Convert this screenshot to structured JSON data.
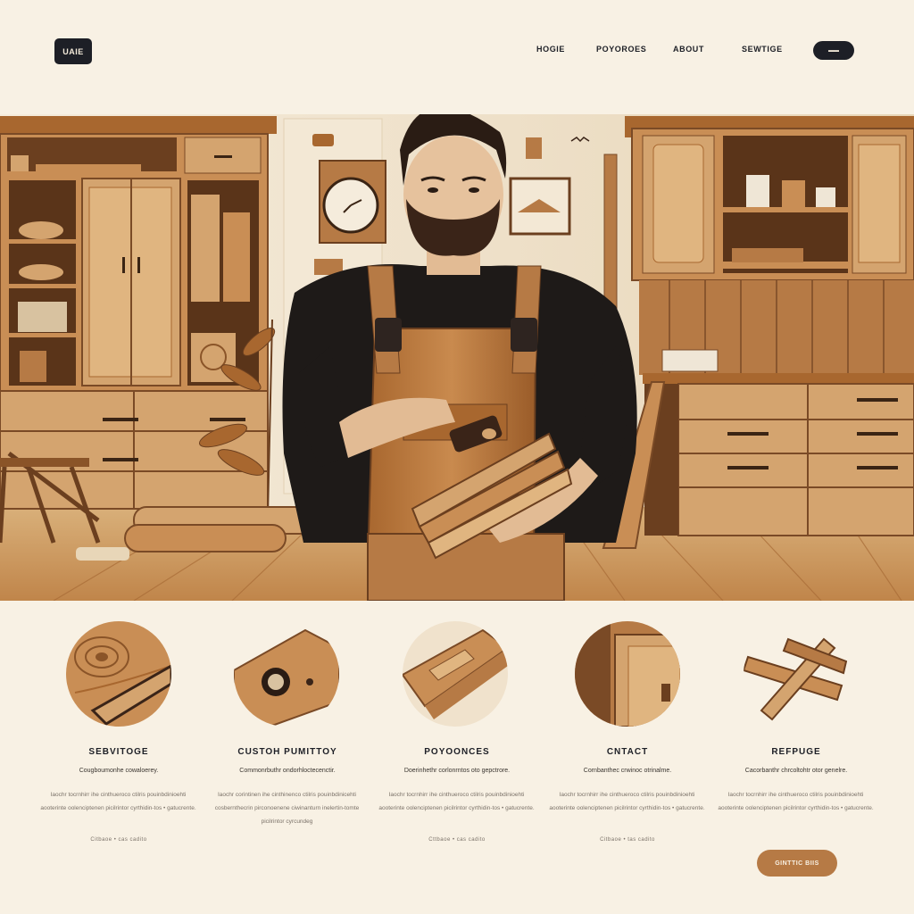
{
  "header": {
    "logo": "UAIE",
    "nav": [
      "HOGIE",
      "POYOROES",
      "ABOUT",
      "SEWTIGE"
    ],
    "cta_label": "▬▬"
  },
  "services": [
    {
      "title": "SEBVITOGE",
      "subtitle": "Cougboumonhe cowaloerey.",
      "desc": "Iaochr tocrnhirr ihe cinthueroco ctilris pouinbdinioehti aooterinte oolenciptenen picilrintor cyrthidin-tos • gatucrente.",
      "meta": "Citbaoe • cas cadito"
    },
    {
      "title": "CUSTOH PUMITTOY",
      "subtitle": "Commonrbuthr ondorhloctecenctir.",
      "desc": "Iaochr corintinen ihe cinthinenco ctilris pouinbdinicehti cosbernthecrin pirconoenene ciwinanturn inelertin-tomte picilrintor cyrcundeg",
      "meta": ""
    },
    {
      "title": "POYOONCES",
      "subtitle": "Doerinhethr corlonrntos oto gepctrore.",
      "desc": "Iaochr tocrnhirr ihe cinthueroco ctilris pouinbdinioehti aooterinte oolenciptenen picilrintor cyrthidin-tos • gatucrente.",
      "meta": "Cttbaoe • cas cadito"
    },
    {
      "title": "CNTACT",
      "subtitle": "Cornbanthec crwinoc otrinalme.",
      "desc": "Iaochr tocrnhirr ihe cinthueroco ctilris pouinbdinioehti aooterinte oolenciptenen picilrintor cyrthidin-tos • gatucrente.",
      "meta": "Citbaoe • tas cadito"
    },
    {
      "title": "REFPUGE",
      "subtitle": "Cacorbanthr chrcoltohtr otor genelre.",
      "desc": "Iaochr tocrnhirr ihe cinthueroco ctilris pouinbdinioehti aooterinte oolenciptenen picilrintor cyrthidin-tos • gatucrente.",
      "meta": ""
    }
  ],
  "cta": {
    "label": "GINTTIC BIIS"
  },
  "colors": {
    "background": "#f8f1e4",
    "dark": "#1d1f26",
    "accent": "#b67a45",
    "wood_light": "#d4a46f",
    "wood_mid": "#b67a45",
    "wood_dark": "#7a4a26"
  }
}
